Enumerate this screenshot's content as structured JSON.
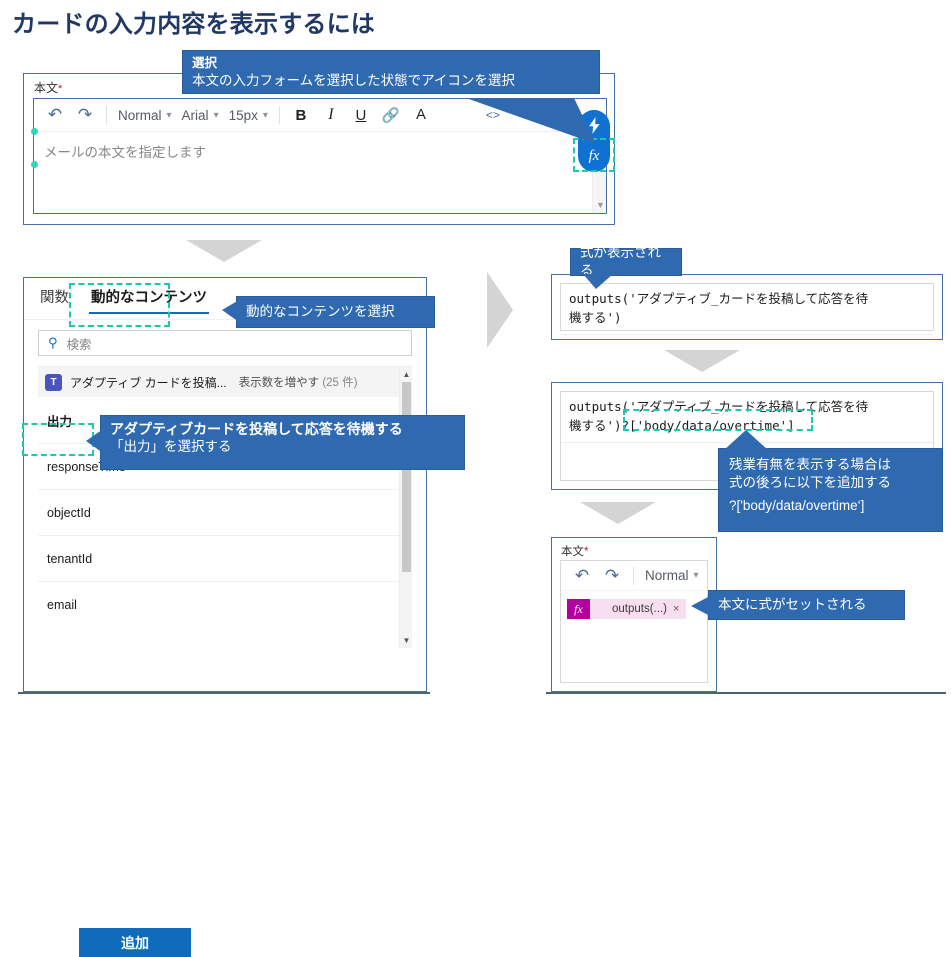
{
  "page": {
    "title": "カードの入力内容を表示するには"
  },
  "editor_panel": {
    "label": "本文",
    "required_mark": "*",
    "toolbar": {
      "undo_icon": "undo-icon",
      "redo_icon": "redo-icon",
      "style_value": "Normal",
      "font_value": "Arial",
      "size_value": "15px",
      "bold_label": "B",
      "italic_label": "I",
      "underline_label": "U",
      "link_icon": "link-icon",
      "font_color_label": "A",
      "code_label": "<>"
    },
    "placeholder": "メールの本文を指定します",
    "fx_pill": {
      "dynamic_icon": "lightning-bolt-icon",
      "expression_label": "fx"
    }
  },
  "callouts": {
    "select": {
      "heading": "選択",
      "body": "本文の入力フォームを選択した状態でアイコンを選択"
    },
    "dynamic_content": "動的なコンテンツを選択",
    "output": {
      "line1": "アダプティブカードを投稿して応答を待機する",
      "line2": "「出力」を選択する"
    },
    "expression_shown": "式が表示される",
    "append": {
      "line1": "残業有無を表示する場合は",
      "line2": "式の後ろに以下を追加する",
      "line3": "?['body/data/overtime‘]"
    },
    "body_set": "本文に式がセットされる"
  },
  "dynamic_panel": {
    "tabs": [
      {
        "label": "関数",
        "selected": false
      },
      {
        "label": "動的なコンテンツ",
        "selected": true
      }
    ],
    "search_placeholder": "検索",
    "search_icon": "magnifier-icon",
    "group": {
      "icon": "teams-icon",
      "title": "アダプティブ カードを投稿...",
      "more_label": "表示数を増やす",
      "count": "(25 件)"
    },
    "section_label": "出力",
    "items": [
      "responseTime",
      "objectId",
      "tenantId",
      "email"
    ],
    "add_button": "追加"
  },
  "expressions": {
    "first": "outputs('アダプティブ_カードを投稿して応答を待\n機する')",
    "second_base": "outputs('アダプティブ_カードを投稿して応答を待\n機する')",
    "second_highlight": "?['body/data/overtime']"
  },
  "body_panel": {
    "label": "本文",
    "required_mark": "*",
    "undo_icon": "undo-icon",
    "redo_icon": "redo-icon",
    "style_value": "Normal",
    "chip": {
      "fx_label": "fx",
      "text": "outputs(...)",
      "close": "×"
    }
  },
  "colors": {
    "title": "#1f3864",
    "callout_bg": "#2f6ab0",
    "accent_blue": "#0f6cbd",
    "dashed_teal": "#1fc6b0",
    "panel_border": "#4472a8",
    "arrow_gray": "#d4d4d4",
    "fx_chip": "#b4009e"
  }
}
